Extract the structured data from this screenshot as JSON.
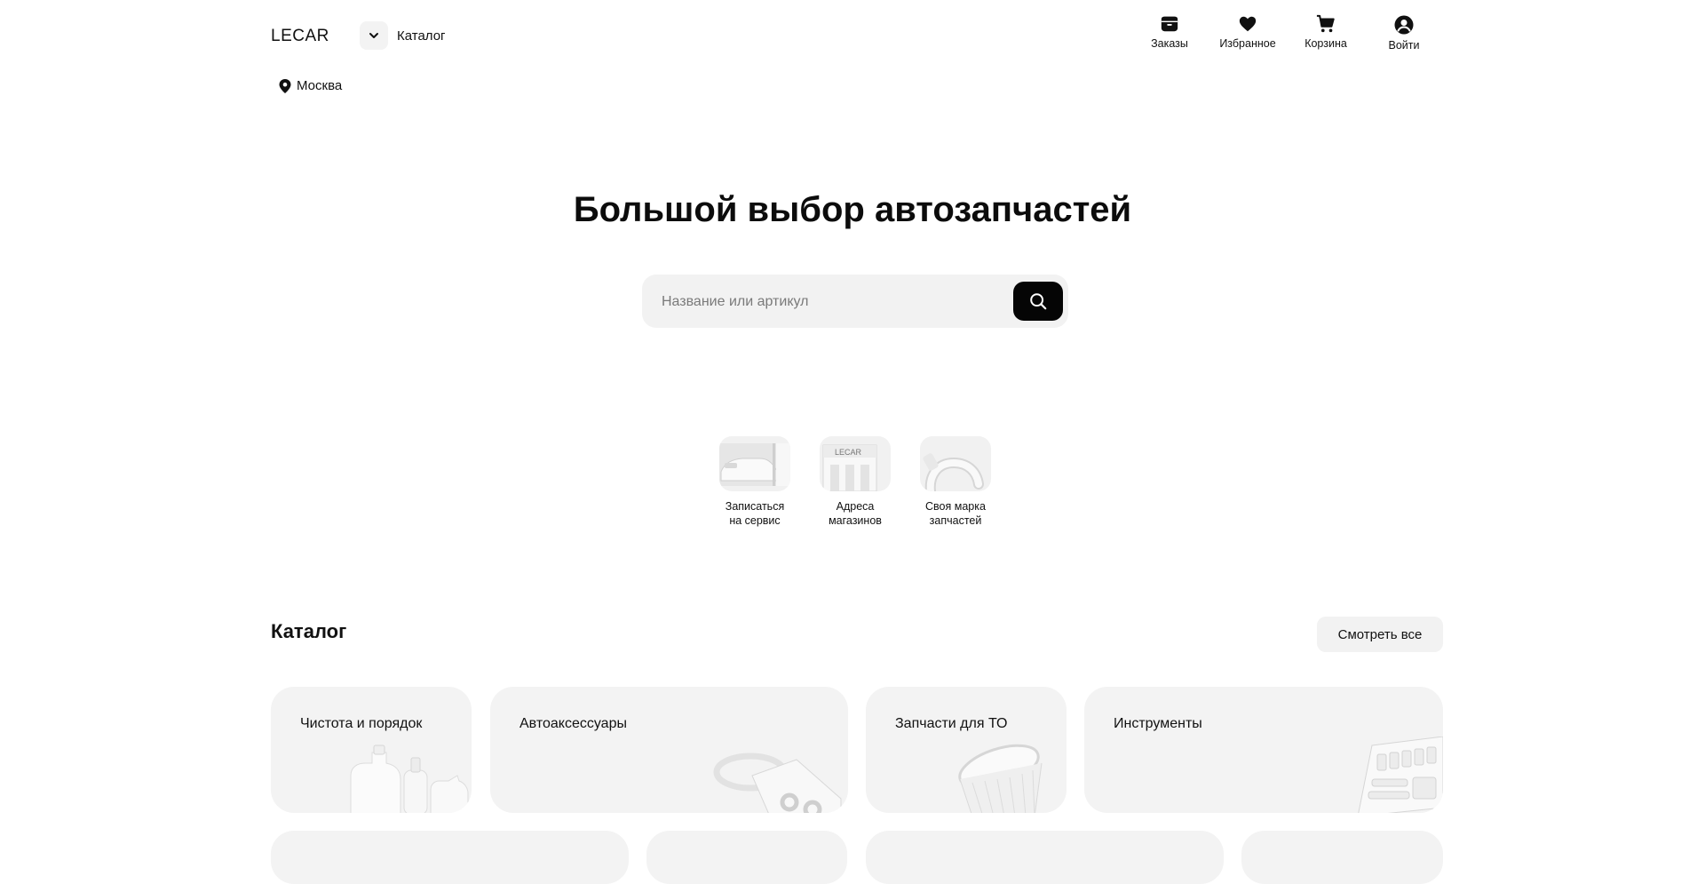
{
  "header": {
    "logo": "LECAR",
    "catalog_label": "Каталог",
    "nav": [
      {
        "label": "Заказы",
        "icon": "box-icon"
      },
      {
        "label": "Избранное",
        "icon": "heart-icon"
      },
      {
        "label": "Корзина",
        "icon": "cart-icon"
      },
      {
        "label": "Войти",
        "icon": "user-icon"
      }
    ]
  },
  "location": {
    "city": "Москва"
  },
  "hero": {
    "title": "Большой выбор автозапчастей",
    "search_placeholder": "Название или артикул"
  },
  "quick_links": [
    {
      "line1": "Записаться",
      "line2": "на сервис"
    },
    {
      "line1": "Адреса",
      "line2": "магазинов"
    },
    {
      "line1": "Своя марка",
      "line2": "запчастей"
    }
  ],
  "catalog": {
    "title": "Каталог",
    "see_all": "Смотреть все",
    "cards": [
      {
        "title": "Чистота и порядок"
      },
      {
        "title": "Автоаксессуары"
      },
      {
        "title": "Запчасти для ТО"
      },
      {
        "title": "Инструменты"
      }
    ]
  },
  "colors": {
    "accent": "#050505",
    "surface": "#f3f3f3"
  }
}
